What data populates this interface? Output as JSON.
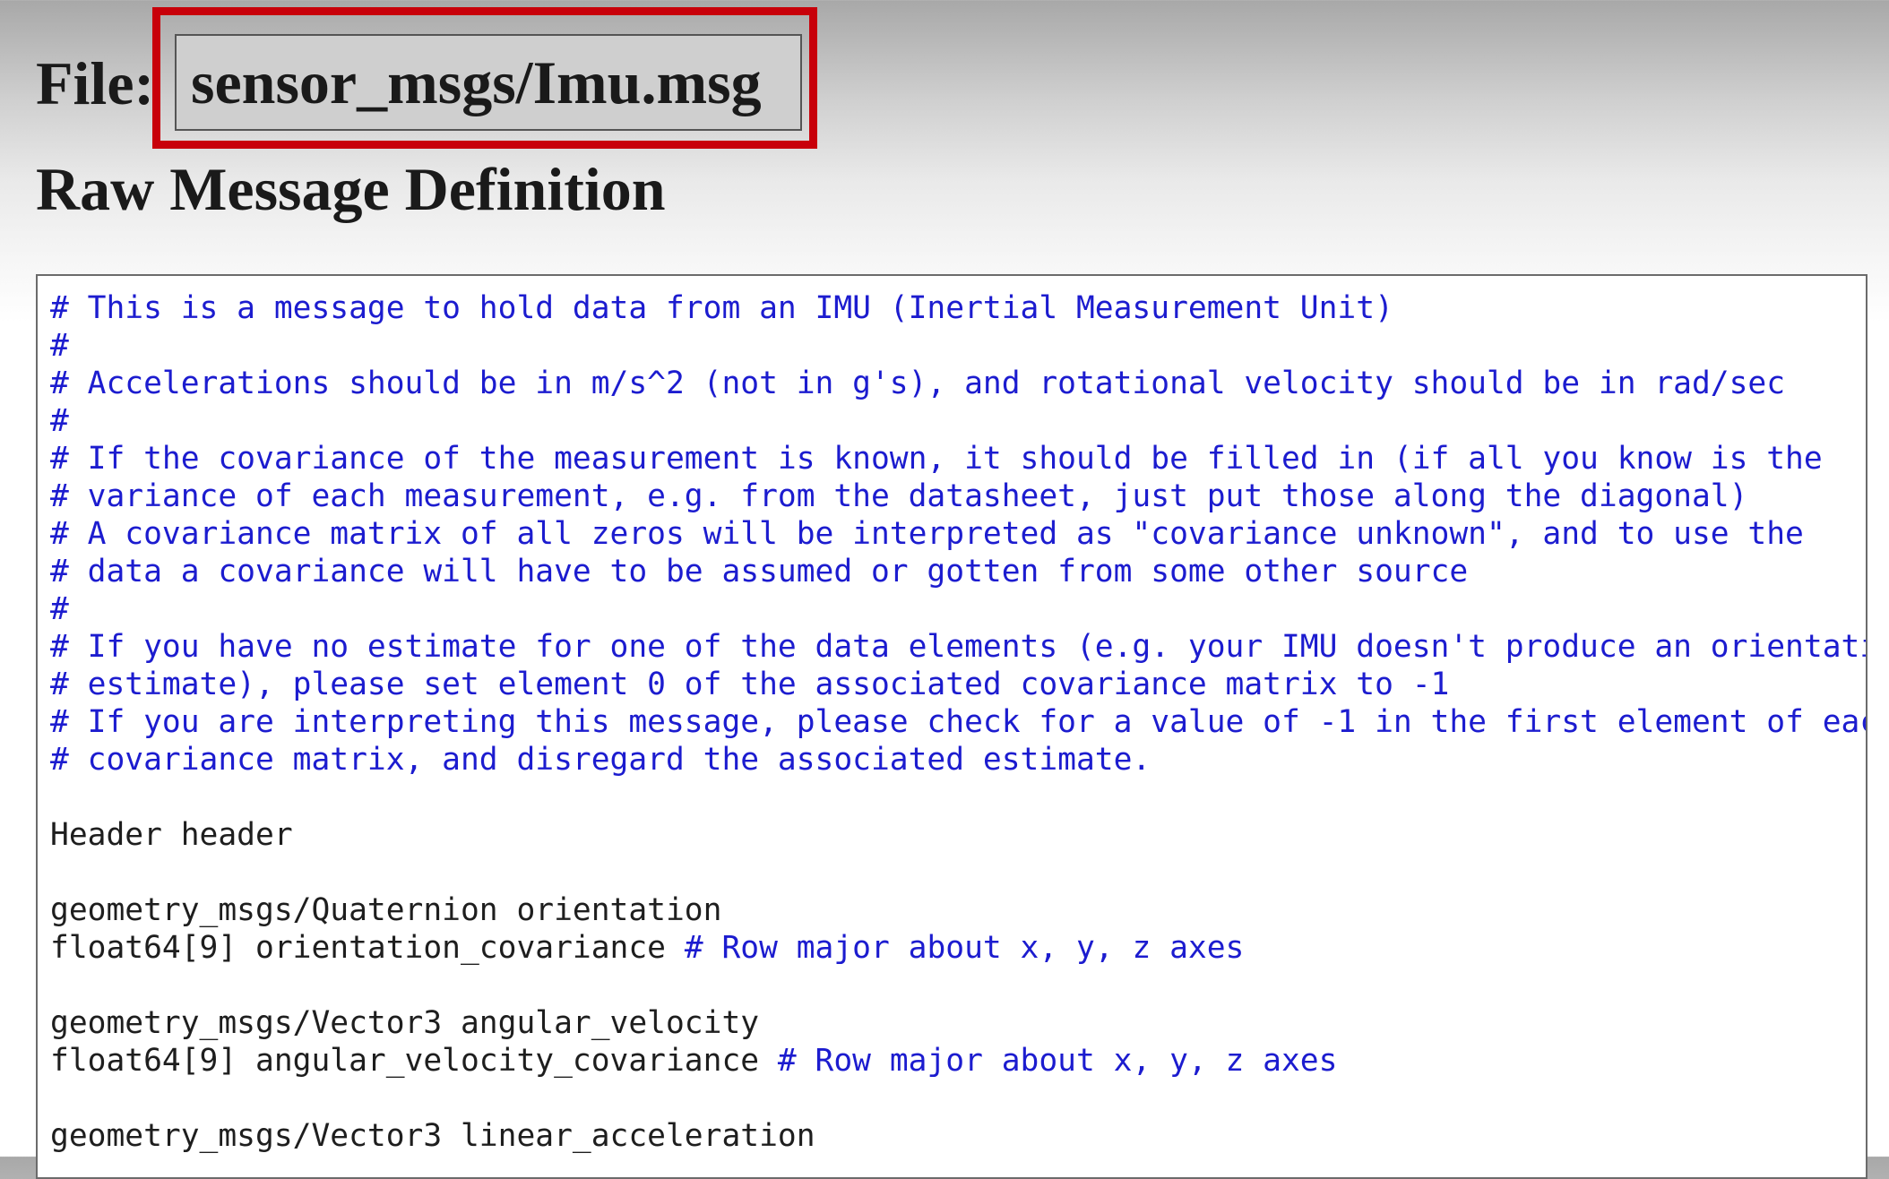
{
  "header": {
    "file_label": "File: ",
    "filename": "sensor_msgs/Imu.msg",
    "section_title": "Raw Message Definition"
  },
  "colors": {
    "highlight": "#c8000a",
    "comment": "#1c1ccf",
    "code": "#1e1e1e",
    "filename_bg": "#cfcfcf"
  },
  "code": {
    "lines": [
      {
        "code": "",
        "comment": "# This is a message to hold data from an IMU (Inertial Measurement Unit)"
      },
      {
        "code": "",
        "comment": "#"
      },
      {
        "code": "",
        "comment": "# Accelerations should be in m/s^2 (not in g's), and rotational velocity should be in rad/sec"
      },
      {
        "code": "",
        "comment": "#"
      },
      {
        "code": "",
        "comment": "# If the covariance of the measurement is known, it should be filled in (if all you know is the"
      },
      {
        "code": "",
        "comment": "# variance of each measurement, e.g. from the datasheet, just put those along the diagonal)"
      },
      {
        "code": "",
        "comment": "# A covariance matrix of all zeros will be interpreted as \"covariance unknown\", and to use the"
      },
      {
        "code": "",
        "comment": "# data a covariance will have to be assumed or gotten from some other source"
      },
      {
        "code": "",
        "comment": "#"
      },
      {
        "code": "",
        "comment": "# If you have no estimate for one of the data elements (e.g. your IMU doesn't produce an orientation"
      },
      {
        "code": "",
        "comment": "# estimate), please set element 0 of the associated covariance matrix to -1"
      },
      {
        "code": "",
        "comment": "# If you are interpreting this message, please check for a value of -1 in the first element of each"
      },
      {
        "code": "",
        "comment": "# covariance matrix, and disregard the associated estimate."
      },
      {
        "code": "",
        "comment": ""
      },
      {
        "code": "Header header",
        "comment": ""
      },
      {
        "code": "",
        "comment": ""
      },
      {
        "code": "geometry_msgs/Quaternion orientation",
        "comment": ""
      },
      {
        "code": "float64[9] orientation_covariance ",
        "comment": "# Row major about x, y, z axes"
      },
      {
        "code": "",
        "comment": ""
      },
      {
        "code": "geometry_msgs/Vector3 angular_velocity",
        "comment": ""
      },
      {
        "code": "float64[9] angular_velocity_covariance ",
        "comment": "# Row major about x, y, z axes"
      },
      {
        "code": "",
        "comment": ""
      },
      {
        "code": "geometry_msgs/Vector3 linear_acceleration",
        "comment": ""
      }
    ]
  }
}
